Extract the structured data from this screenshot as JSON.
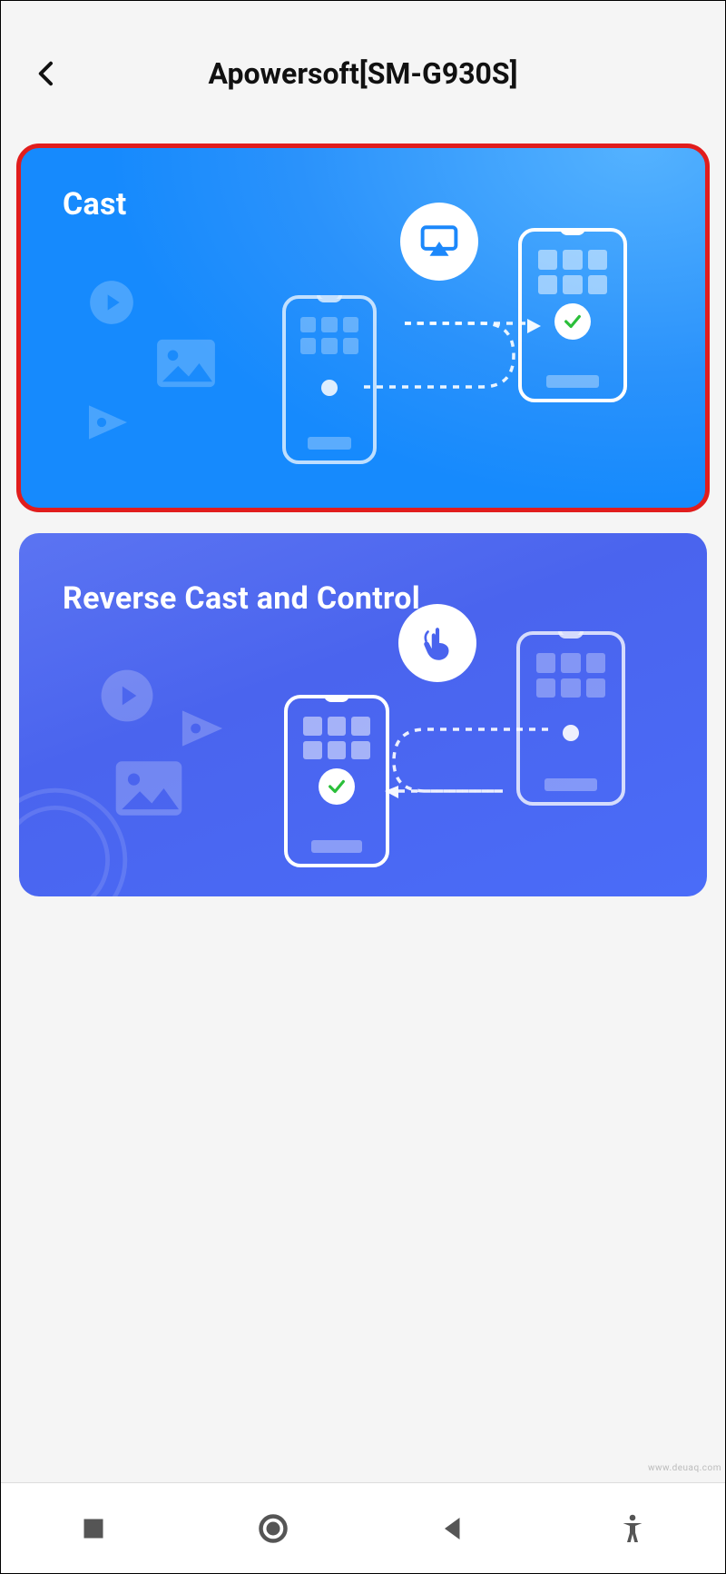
{
  "header": {
    "title": "Apowersoft[SM-G930S]"
  },
  "cards": {
    "cast": {
      "title": "Cast",
      "selected": true
    },
    "reverse": {
      "title": "Reverse Cast and Control",
      "selected": false
    }
  },
  "watermark": "www.deuaq.com"
}
